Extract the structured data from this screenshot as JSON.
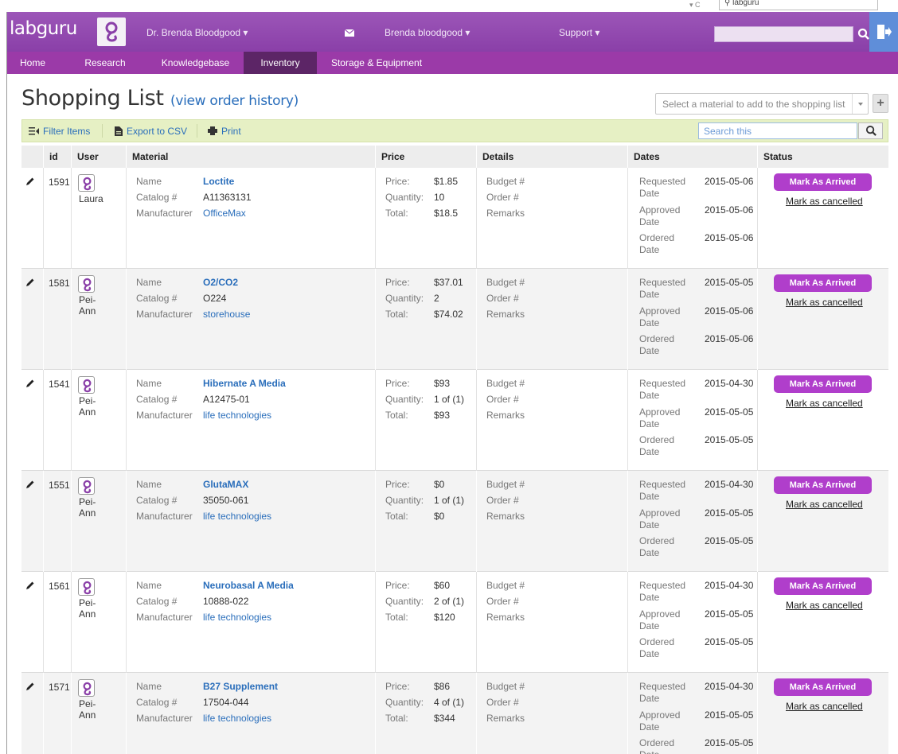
{
  "browser": {
    "search_text": "labguru"
  },
  "header": {
    "logo_text": "labguru",
    "user_menu": "Dr. Brenda Bloodgood ▾",
    "team_menu": "Brenda bloodgood ▾",
    "support_menu": "Support ▾",
    "search_value": ""
  },
  "nav": {
    "items": [
      {
        "label": "Home"
      },
      {
        "label": "Research"
      },
      {
        "label": "Knowledgebase"
      },
      {
        "label": "Inventory",
        "active": true
      },
      {
        "label": "Storage & Equipment"
      }
    ]
  },
  "page": {
    "title": "Shopping List",
    "history_link": "(view order history)",
    "add_material_placeholder": "Select a material to add to the shopping list"
  },
  "toolbar": {
    "filter": "Filter Items",
    "export": "Export to CSV",
    "print": "Print",
    "search_placeholder": "Search this"
  },
  "columns": [
    "id",
    "User",
    "Material",
    "Price",
    "Details",
    "Dates",
    "Status"
  ],
  "labels": {
    "name": "Name",
    "catalog": "Catalog #",
    "manufacturer": "Manufacturer",
    "price": "Price:",
    "quantity": "Quantity:",
    "total": "Total:",
    "budget": "Budget #",
    "order": "Order #",
    "remarks": "Remarks",
    "requested": "Requested Date",
    "approved": "Approved Date",
    "ordered": "Ordered Date",
    "arrived_button": "Mark As Arrived",
    "cancel_link": "Mark as cancelled"
  },
  "rows": [
    {
      "id": "1591",
      "user": "Laura",
      "name": "Loctite",
      "catalog": "A11363131",
      "manufacturer": "OfficeMax",
      "price": "$1.85",
      "quantity": "10",
      "total": "$18.5",
      "requested": "2015-05-06",
      "approved": "2015-05-06",
      "ordered": "2015-05-06"
    },
    {
      "id": "1581",
      "user": "Pei-Ann",
      "name": "O2/CO2",
      "catalog": "O224",
      "manufacturer": "storehouse",
      "price": "$37.01",
      "quantity": "2",
      "total": "$74.02",
      "requested": "2015-05-05",
      "approved": "2015-05-06",
      "ordered": "2015-05-06"
    },
    {
      "id": "1541",
      "user": "Pei-Ann",
      "name": "Hibernate A Media",
      "catalog": "A12475-01",
      "manufacturer": "life technologies",
      "price": "$93",
      "quantity": "1 of (1)",
      "total": "$93",
      "requested": "2015-04-30",
      "approved": "2015-05-05",
      "ordered": "2015-05-05"
    },
    {
      "id": "1551",
      "user": "Pei-Ann",
      "name": "GlutaMAX",
      "catalog": "35050-061",
      "manufacturer": "life technologies",
      "price": "$0",
      "quantity": "1 of (1)",
      "total": "$0",
      "requested": "2015-04-30",
      "approved": "2015-05-05",
      "ordered": "2015-05-05"
    },
    {
      "id": "1561",
      "user": "Pei-Ann",
      "name": "Neurobasal A Media",
      "catalog": "10888-022",
      "manufacturer": "life technologies",
      "price": "$60",
      "quantity": "2 of (1)",
      "total": "$120",
      "requested": "2015-04-30",
      "approved": "2015-05-05",
      "ordered": "2015-05-05"
    },
    {
      "id": "1571",
      "user": "Pei-Ann",
      "name": "B27 Supplement",
      "catalog": "17504-044",
      "manufacturer": "life technologies",
      "price": "$86",
      "quantity": "4 of (1)",
      "total": "$344",
      "requested": "2015-04-30",
      "approved": "2015-05-05",
      "ordered": "2015-05-05"
    }
  ],
  "colors": {
    "brand": "#9b3aa8",
    "nav_active": "#5c2566",
    "button": "#b03ecb",
    "link": "#2a6ebb",
    "toolbar_bg": "#e6f0c4"
  }
}
